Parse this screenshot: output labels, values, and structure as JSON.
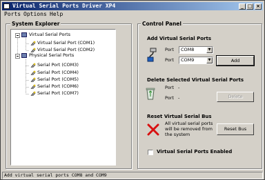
{
  "window": {
    "title": "Virtual Serial Ports Driver XP4"
  },
  "menu": [
    "Ports",
    "Options",
    "Help"
  ],
  "explorer": {
    "title": "System Explorer",
    "virtual_group": "Virtual Serial Ports",
    "virtual_items": [
      "Virtual Serial Port (COM1)",
      "Virtual Serial Port (COM2)"
    ],
    "physical_group": "Physical Serial Ports",
    "physical_items": [
      "Serial Port (COM3)",
      "Serial Port (COM4)",
      "Serial Port (COM5)",
      "Serial Port (COM6)",
      "Serial Port (COM7)"
    ]
  },
  "control": {
    "title": "Control Panel",
    "add": {
      "title": "Add Virtual Serial Ports",
      "port_label": "Port",
      "port1": "COM8",
      "port2": "COM9",
      "button": "Add"
    },
    "delete": {
      "title": "Delete Selected Virtual Serial Ports",
      "port_label": "Port",
      "port_value": "-",
      "button": "Delete"
    },
    "reset": {
      "title": "Reset Virtual Serial Bus",
      "desc": [
        "All virtual serial ports",
        "will be removed from",
        "the system"
      ],
      "button": "Reset Bus"
    },
    "enabled_label": "Virtual Serial Ports Enabled"
  },
  "status": "Add virtual serial ports COM8 and COM9"
}
